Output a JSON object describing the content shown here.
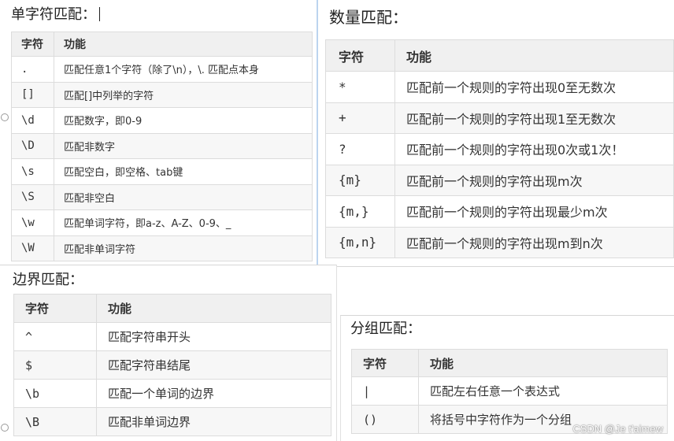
{
  "single": {
    "title": "单字符匹配：",
    "headers": [
      "字符",
      "功能"
    ],
    "rows": [
      [
        ".",
        "匹配任意1个字符（除了\\n），\\. 匹配点本身"
      ],
      [
        "[]",
        "匹配[]中列举的字符"
      ],
      [
        "\\d",
        "匹配数字，即0-9"
      ],
      [
        "\\D",
        "匹配非数字"
      ],
      [
        "\\s",
        "匹配空白，即空格、tab键"
      ],
      [
        "\\S",
        "匹配非空白"
      ],
      [
        "\\w",
        "匹配单词字符，即a-z、A-Z、0-9、_"
      ],
      [
        "\\W",
        "匹配非单词字符"
      ]
    ]
  },
  "quantity": {
    "title": "数量匹配：",
    "headers": [
      "字符",
      "功能"
    ],
    "rows": [
      [
        "*",
        "匹配前一个规则的字符出现0至无数次"
      ],
      [
        "+",
        "匹配前一个规则的字符出现1至无数次"
      ],
      [
        "?",
        "匹配前一个规则的字符出现0次或1次！"
      ],
      [
        "{m}",
        "匹配前一个规则的字符出现m次"
      ],
      [
        "{m,}",
        "匹配前一个规则的字符出现最少m次"
      ],
      [
        "{m,n}",
        "匹配前一个规则的字符出现m到n次"
      ]
    ]
  },
  "boundary": {
    "title": "边界匹配：",
    "headers": [
      "字符",
      "功能"
    ],
    "rows": [
      [
        "^",
        "匹配字符串开头"
      ],
      [
        "$",
        "匹配字符串结尾"
      ],
      [
        "\\b",
        "匹配一个单词的边界"
      ],
      [
        "\\B",
        "匹配非单词边界"
      ]
    ]
  },
  "group": {
    "title": "分组匹配：",
    "headers": [
      "字符",
      "功能"
    ],
    "rows": [
      [
        "|",
        "匹配左右任意一个表达式"
      ],
      [
        "()",
        "将括号中字符作为一个分组"
      ]
    ]
  },
  "watermark": "CSDN @Je t'aimew"
}
